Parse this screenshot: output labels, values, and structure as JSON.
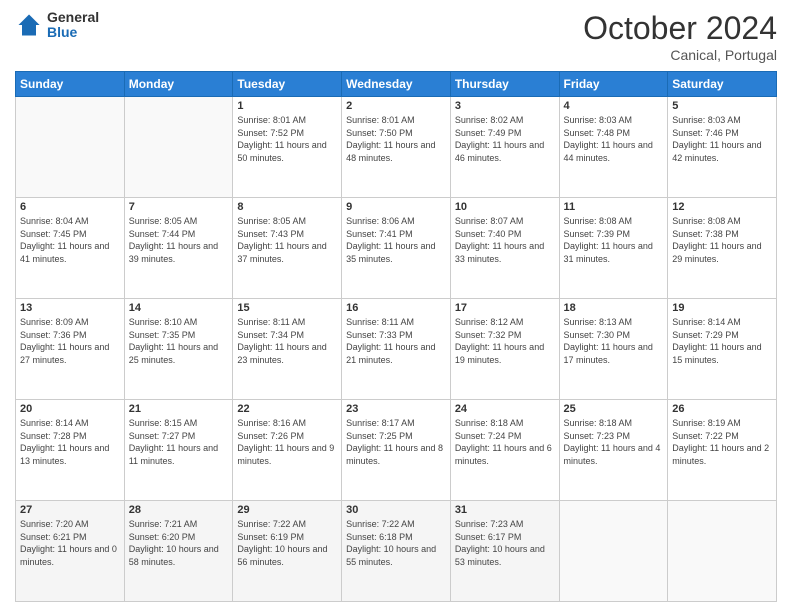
{
  "header": {
    "logo_general": "General",
    "logo_blue": "Blue",
    "month_title": "October 2024",
    "location": "Canical, Portugal"
  },
  "days_of_week": [
    "Sunday",
    "Monday",
    "Tuesday",
    "Wednesday",
    "Thursday",
    "Friday",
    "Saturday"
  ],
  "weeks": [
    [
      {
        "day": "",
        "content": ""
      },
      {
        "day": "",
        "content": ""
      },
      {
        "day": "1",
        "content": "Sunrise: 8:01 AM\nSunset: 7:52 PM\nDaylight: 11 hours and 50 minutes."
      },
      {
        "day": "2",
        "content": "Sunrise: 8:01 AM\nSunset: 7:50 PM\nDaylight: 11 hours and 48 minutes."
      },
      {
        "day": "3",
        "content": "Sunrise: 8:02 AM\nSunset: 7:49 PM\nDaylight: 11 hours and 46 minutes."
      },
      {
        "day": "4",
        "content": "Sunrise: 8:03 AM\nSunset: 7:48 PM\nDaylight: 11 hours and 44 minutes."
      },
      {
        "day": "5",
        "content": "Sunrise: 8:03 AM\nSunset: 7:46 PM\nDaylight: 11 hours and 42 minutes."
      }
    ],
    [
      {
        "day": "6",
        "content": "Sunrise: 8:04 AM\nSunset: 7:45 PM\nDaylight: 11 hours and 41 minutes."
      },
      {
        "day": "7",
        "content": "Sunrise: 8:05 AM\nSunset: 7:44 PM\nDaylight: 11 hours and 39 minutes."
      },
      {
        "day": "8",
        "content": "Sunrise: 8:05 AM\nSunset: 7:43 PM\nDaylight: 11 hours and 37 minutes."
      },
      {
        "day": "9",
        "content": "Sunrise: 8:06 AM\nSunset: 7:41 PM\nDaylight: 11 hours and 35 minutes."
      },
      {
        "day": "10",
        "content": "Sunrise: 8:07 AM\nSunset: 7:40 PM\nDaylight: 11 hours and 33 minutes."
      },
      {
        "day": "11",
        "content": "Sunrise: 8:08 AM\nSunset: 7:39 PM\nDaylight: 11 hours and 31 minutes."
      },
      {
        "day": "12",
        "content": "Sunrise: 8:08 AM\nSunset: 7:38 PM\nDaylight: 11 hours and 29 minutes."
      }
    ],
    [
      {
        "day": "13",
        "content": "Sunrise: 8:09 AM\nSunset: 7:36 PM\nDaylight: 11 hours and 27 minutes."
      },
      {
        "day": "14",
        "content": "Sunrise: 8:10 AM\nSunset: 7:35 PM\nDaylight: 11 hours and 25 minutes."
      },
      {
        "day": "15",
        "content": "Sunrise: 8:11 AM\nSunset: 7:34 PM\nDaylight: 11 hours and 23 minutes."
      },
      {
        "day": "16",
        "content": "Sunrise: 8:11 AM\nSunset: 7:33 PM\nDaylight: 11 hours and 21 minutes."
      },
      {
        "day": "17",
        "content": "Sunrise: 8:12 AM\nSunset: 7:32 PM\nDaylight: 11 hours and 19 minutes."
      },
      {
        "day": "18",
        "content": "Sunrise: 8:13 AM\nSunset: 7:30 PM\nDaylight: 11 hours and 17 minutes."
      },
      {
        "day": "19",
        "content": "Sunrise: 8:14 AM\nSunset: 7:29 PM\nDaylight: 11 hours and 15 minutes."
      }
    ],
    [
      {
        "day": "20",
        "content": "Sunrise: 8:14 AM\nSunset: 7:28 PM\nDaylight: 11 hours and 13 minutes."
      },
      {
        "day": "21",
        "content": "Sunrise: 8:15 AM\nSunset: 7:27 PM\nDaylight: 11 hours and 11 minutes."
      },
      {
        "day": "22",
        "content": "Sunrise: 8:16 AM\nSunset: 7:26 PM\nDaylight: 11 hours and 9 minutes."
      },
      {
        "day": "23",
        "content": "Sunrise: 8:17 AM\nSunset: 7:25 PM\nDaylight: 11 hours and 8 minutes."
      },
      {
        "day": "24",
        "content": "Sunrise: 8:18 AM\nSunset: 7:24 PM\nDaylight: 11 hours and 6 minutes."
      },
      {
        "day": "25",
        "content": "Sunrise: 8:18 AM\nSunset: 7:23 PM\nDaylight: 11 hours and 4 minutes."
      },
      {
        "day": "26",
        "content": "Sunrise: 8:19 AM\nSunset: 7:22 PM\nDaylight: 11 hours and 2 minutes."
      }
    ],
    [
      {
        "day": "27",
        "content": "Sunrise: 7:20 AM\nSunset: 6:21 PM\nDaylight: 11 hours and 0 minutes."
      },
      {
        "day": "28",
        "content": "Sunrise: 7:21 AM\nSunset: 6:20 PM\nDaylight: 10 hours and 58 minutes."
      },
      {
        "day": "29",
        "content": "Sunrise: 7:22 AM\nSunset: 6:19 PM\nDaylight: 10 hours and 56 minutes."
      },
      {
        "day": "30",
        "content": "Sunrise: 7:22 AM\nSunset: 6:18 PM\nDaylight: 10 hours and 55 minutes."
      },
      {
        "day": "31",
        "content": "Sunrise: 7:23 AM\nSunset: 6:17 PM\nDaylight: 10 hours and 53 minutes."
      },
      {
        "day": "",
        "content": ""
      },
      {
        "day": "",
        "content": ""
      }
    ]
  ]
}
